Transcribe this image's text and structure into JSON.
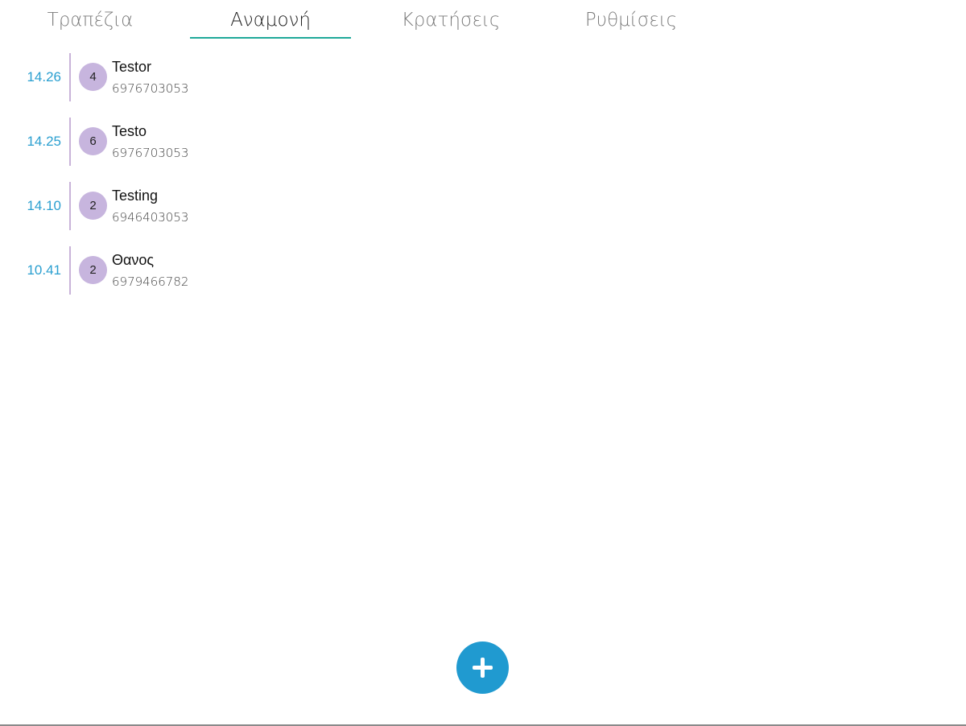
{
  "tabs": [
    {
      "label": "Τραπέζια",
      "active": false
    },
    {
      "label": "Αναμονή",
      "active": true
    },
    {
      "label": "Κρατήσεις",
      "active": false
    },
    {
      "label": "Ρυθμίσεις",
      "active": false
    }
  ],
  "waitlist": [
    {
      "time": "14.26",
      "party_size": "4",
      "name": "Testor",
      "phone": "6976703053"
    },
    {
      "time": "14.25",
      "party_size": "6",
      "name": "Testo",
      "phone": "6976703053"
    },
    {
      "time": "14.10",
      "party_size": "2",
      "name": "Testing",
      "phone": "6946403053"
    },
    {
      "time": "10.41",
      "party_size": "2",
      "name": "Θανος",
      "phone": "6979466782"
    }
  ],
  "fab": {
    "icon": "plus-icon"
  },
  "colors": {
    "accent_tab_underline": "#1fa99a",
    "time_text": "#2a9fd0",
    "badge_bg": "#c7b5de",
    "divider": "#c9b3d9",
    "fab_bg": "#209ad0"
  }
}
